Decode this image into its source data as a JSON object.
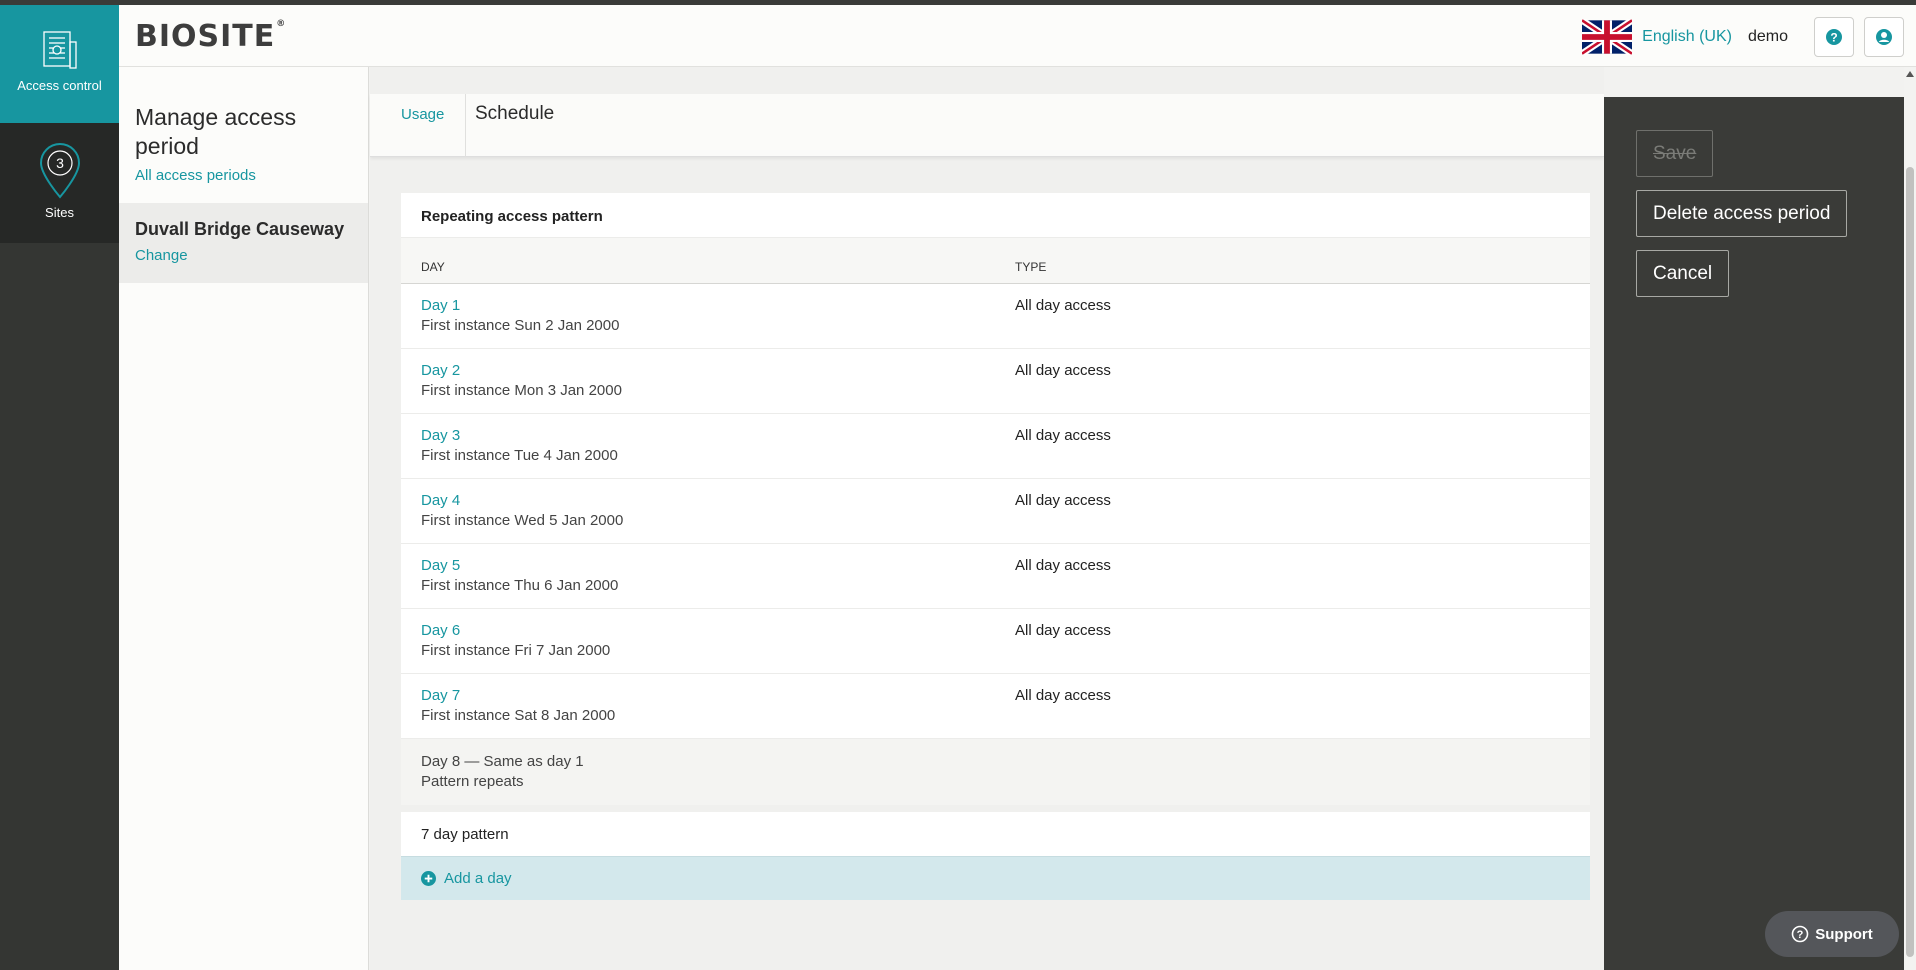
{
  "app": {
    "logo": "BIOSITE",
    "logo_mark": "®"
  },
  "nav": {
    "access_control": "Access control",
    "sites": "Sites",
    "sites_badge": "3"
  },
  "header": {
    "language": "English (UK)",
    "user": "demo"
  },
  "sidebar": {
    "title": "Manage access period",
    "all_link": "All access periods",
    "site_name": "Duvall Bridge Causeway",
    "change_link": "Change"
  },
  "tabs": {
    "usage": "Usage",
    "schedule": "Schedule"
  },
  "table": {
    "title": "Repeating access pattern",
    "col_day": "DAY",
    "col_type": "TYPE",
    "rows": [
      {
        "day": "Day 1",
        "instance": "First instance Sun 2 Jan 2000",
        "type": "All day access"
      },
      {
        "day": "Day 2",
        "instance": "First instance Mon 3 Jan 2000",
        "type": "All day access"
      },
      {
        "day": "Day 3",
        "instance": "First instance Tue 4 Jan 2000",
        "type": "All day access"
      },
      {
        "day": "Day 4",
        "instance": "First instance Wed 5 Jan 2000",
        "type": "All day access"
      },
      {
        "day": "Day 5",
        "instance": "First instance Thu 6 Jan 2000",
        "type": "All day access"
      },
      {
        "day": "Day 6",
        "instance": "First instance Fri 7 Jan 2000",
        "type": "All day access"
      },
      {
        "day": "Day 7",
        "instance": "First instance Sat 8 Jan 2000",
        "type": "All day access"
      }
    ],
    "repeat_line1": "Day 8 — Same as day 1",
    "repeat_line2": "Pattern repeats"
  },
  "pattern_label": "7 day pattern",
  "add_day": "Add a day",
  "actions": {
    "save": "Save",
    "delete": "Delete access period",
    "cancel": "Cancel"
  },
  "support": "Support",
  "colors": {
    "accent": "#1796a0",
    "nav_dark": "#343633",
    "panel": "#3a3b38"
  }
}
